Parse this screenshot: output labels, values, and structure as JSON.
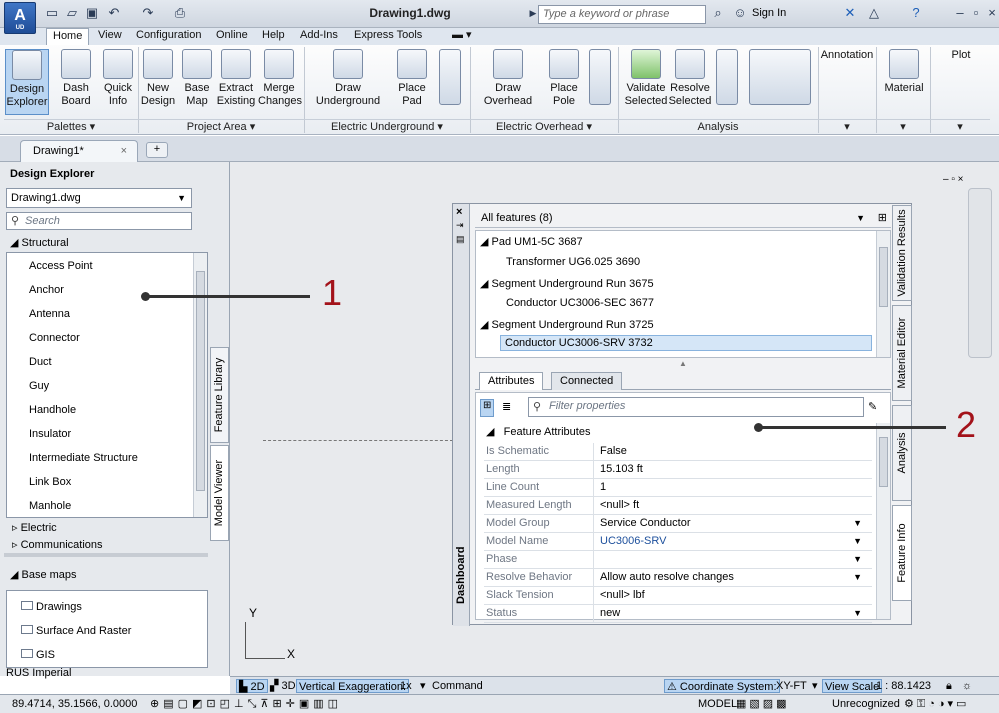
{
  "window": {
    "title": "Drawing1.dwg",
    "search_placeholder": "Type a keyword or phrase",
    "sign_in": "Sign In",
    "app_logo_text": "A",
    "app_logo_sub": "UD"
  },
  "ribbon_tabs": [
    "Home",
    "View",
    "Configuration",
    "Online",
    "Help",
    "Add-Ins",
    "Express Tools"
  ],
  "ribbon_buttons": {
    "design_explorer": "Design Explorer",
    "dash_board": "Dash Board",
    "quick_info": "Quick Info",
    "new_design": "New Design",
    "base_map": "Base Map",
    "extract_existing": "Extract Existing",
    "merge_changes": "Merge Changes",
    "draw_underground": "Draw Underground",
    "place_pad": "Place Pad",
    "draw_overhead": "Draw Overhead",
    "place_pole": "Place Pole",
    "validate_selected": "Validate Selected",
    "resolve_selected": "Resolve Selected",
    "annotation": "Annotation",
    "material": "Material",
    "plot": "Plot"
  },
  "ribbon_groups": {
    "palettes": "Palettes",
    "project_area": "Project Area",
    "electric_underground": "Electric Underground",
    "electric_overhead": "Electric Overhead",
    "analysis": "Analysis"
  },
  "doc_tab": "Drawing1*",
  "design_explorer": {
    "title": "Design Explorer",
    "file": "Drawing1.dwg",
    "search_placeholder": "Search",
    "structural_header": "Structural",
    "structural_items": [
      "Access Point",
      "Anchor",
      "Antenna",
      "Connector",
      "Duct",
      "Guy",
      "Handhole",
      "Insulator",
      "Intermediate Structure",
      "Link Box",
      "Manhole"
    ],
    "electric": "Electric",
    "communications": "Communications",
    "base_maps_header": "Base maps",
    "base_maps": [
      "Drawings",
      "Surface And Raster",
      "GIS"
    ],
    "units": "RUS Imperial",
    "side_tabs": [
      "Feature Library",
      "Model Viewer"
    ]
  },
  "dashboard": {
    "label": "Dashboard",
    "filter_label": "All features (8)",
    "tree": [
      {
        "text": "Pad UM1-5C 3687",
        "level": 0
      },
      {
        "text": "Transformer UG6.025 3690",
        "level": 1
      },
      {
        "text": "Segment Underground Run 3675",
        "level": 0
      },
      {
        "text": "Conductor UC3006-SEC 3677",
        "level": 1
      },
      {
        "text": "Segment Underground Run 3725",
        "level": 0
      },
      {
        "text": "Conductor UC3006-SRV 3732",
        "level": 1
      }
    ],
    "tabs": [
      "Attributes",
      "Connected"
    ],
    "filter_placeholder": "Filter properties",
    "section": "Feature Attributes",
    "properties": [
      {
        "k": "Is Schematic",
        "v": "False"
      },
      {
        "k": "Length",
        "v": "15.103 ft"
      },
      {
        "k": "Line Count",
        "v": "1"
      },
      {
        "k": "Measured Length",
        "v": "<null> ft"
      },
      {
        "k": "Model Group",
        "v": "Service Conductor"
      },
      {
        "k": "Model Name",
        "v": "UC3006-SRV"
      },
      {
        "k": "Phase",
        "v": ""
      },
      {
        "k": "Resolve Behavior",
        "v": "Allow auto resolve changes"
      },
      {
        "k": "Slack Tension",
        "v": "<null> lbf"
      },
      {
        "k": "Status",
        "v": "new"
      }
    ],
    "right_tabs": [
      "Validation Results",
      "Material Editor",
      "Analysis",
      "Feature Info"
    ]
  },
  "callouts": [
    "1",
    "2"
  ],
  "axis": {
    "y": "Y",
    "x": "X"
  },
  "command_bar": {
    "b2d": "2D",
    "b3d": "3D",
    "vert_exag_label": "Vertical Exaggeration:",
    "vert_exag": "1x",
    "command": "Command",
    "coord_sys_label": "Coordinate System:",
    "coord_sys": "XY-FT",
    "view_scale_label": "View Scale",
    "view_scale": "1 : 88.1423"
  },
  "status_bar": {
    "coords": "89.4714, 35.1566, 0.0000",
    "model": "MODEL",
    "unrecognized": "Unrecognized"
  }
}
